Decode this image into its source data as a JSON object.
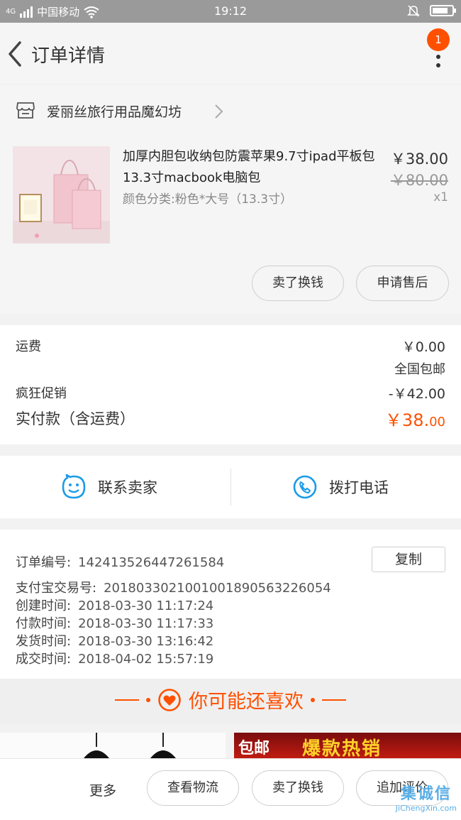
{
  "status_bar": {
    "network": "4G",
    "carrier": "中国移动",
    "time": "19:12",
    "battery_level": 0.8
  },
  "header": {
    "title": "订单详情",
    "badge_count": "1"
  },
  "shop": {
    "name": "爱丽丝旅行用品魔幻坊"
  },
  "item": {
    "title": "加厚内胆包收纳包防震苹果9.7寸ipad平板包13.3寸macbook电脑包",
    "sku": "颜色分类:粉色*大号（13.3寸）",
    "price": "￥38.00",
    "original_price": "￥80.00",
    "quantity": "x1",
    "sell_button": "卖了换钱",
    "after_sale_button": "申请售后"
  },
  "costs": {
    "shipping_label": "运费",
    "shipping_value": "￥0.00",
    "shipping_note": "全国包邮",
    "promo_label": "疯狂促销",
    "promo_value": "-￥42.00",
    "paid_label": "实付款（含运费）",
    "paid_currency": "￥",
    "paid_int": "38.",
    "paid_dec": "00"
  },
  "contact": {
    "seller_label": "联系卖家",
    "call_label": "拨打电话"
  },
  "order_info": {
    "copy_button": "复制",
    "rows": [
      {
        "key": "订单编号:",
        "value": "142413526447261584"
      },
      {
        "key": "支付宝交易号:",
        "value": "2018033021001001890563226054"
      },
      {
        "key": "创建时间:",
        "value": "2018-03-30 11:17:24"
      },
      {
        "key": "付款时间:",
        "value": "2018-03-30 11:17:33"
      },
      {
        "key": "发货时间:",
        "value": "2018-03-30 13:16:42"
      },
      {
        "key": "成交时间:",
        "value": "2018-04-02 15:57:19"
      }
    ]
  },
  "recommend": {
    "title": "你可能还喜欢",
    "banner_left": "包邮",
    "banner_right": "爆款热销"
  },
  "bottom_bar": {
    "more": "更多",
    "logistics": "查看物流",
    "sell": "卖了换钱",
    "review": "追加评价"
  },
  "watermark": {
    "main": "集诚信",
    "sub": "JiChengXin.com"
  },
  "colors": {
    "accent": "#ff5000",
    "icon_blue": "#1a9be8"
  }
}
